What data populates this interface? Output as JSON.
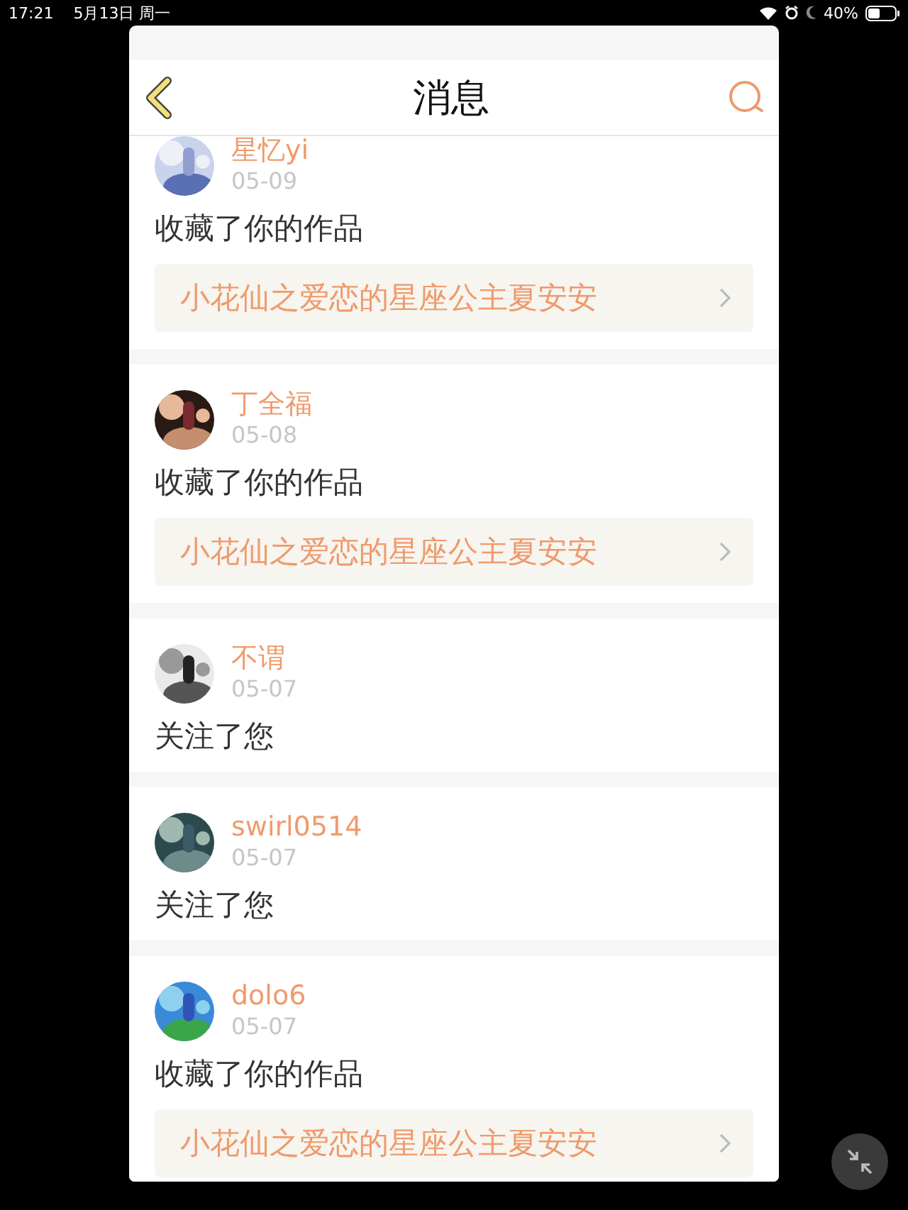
{
  "status_bar": {
    "time": "17:21",
    "date": "5月13日 周一",
    "battery": "40%"
  },
  "header": {
    "title": "消息"
  },
  "messages": [
    {
      "name": "星忆yi",
      "date": "05-09",
      "action": "收藏了你的作品",
      "work": "小花仙之爱恋的星座公主夏安安"
    },
    {
      "name": "丁全福",
      "date": "05-08",
      "action": "收藏了你的作品",
      "work": "小花仙之爱恋的星座公主夏安安"
    },
    {
      "name": "不谓",
      "date": "05-07",
      "action": "关注了您"
    },
    {
      "name": "swirl0514",
      "date": "05-07",
      "action": "关注了您"
    },
    {
      "name": "dolo6",
      "date": "05-07",
      "action": "收藏了你的作品",
      "work": "小花仙之爱恋的星座公主夏安安"
    }
  ]
}
